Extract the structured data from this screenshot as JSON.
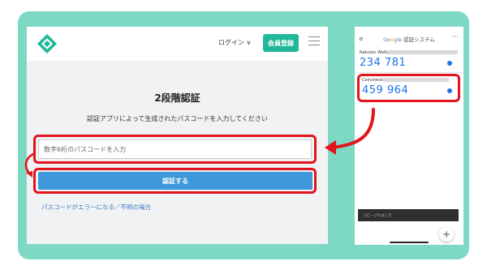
{
  "site": {
    "login_label": "ログイン ∨",
    "register_label": "会員登録",
    "title": "2段階認証",
    "description": "認証アプリによって生成されたパスコードを入力してください",
    "code_placeholder": "数字6桁のパスコードを入力",
    "submit_label": "認証する",
    "help_link": "パスコードがエラーになる／不明の場合"
  },
  "authenticator": {
    "brand": "Google",
    "title_suffix": " 認証システム",
    "accounts": [
      {
        "label": "Rakuten Wallet",
        "code": "234 781"
      },
      {
        "label": "Coincheck",
        "code": "459 964"
      }
    ],
    "toast": "コピーされました",
    "add_label": "+"
  },
  "colors": {
    "frame": "#7ed9c4",
    "brand_green": "#21b89a",
    "submit_blue": "#3f98d9",
    "highlight_red": "#e2141c",
    "code_blue": "#1a73e8"
  },
  "icons": [
    "coincheck-logo",
    "menu-icon",
    "arrow-icon",
    "timer-icon",
    "add-icon"
  ]
}
